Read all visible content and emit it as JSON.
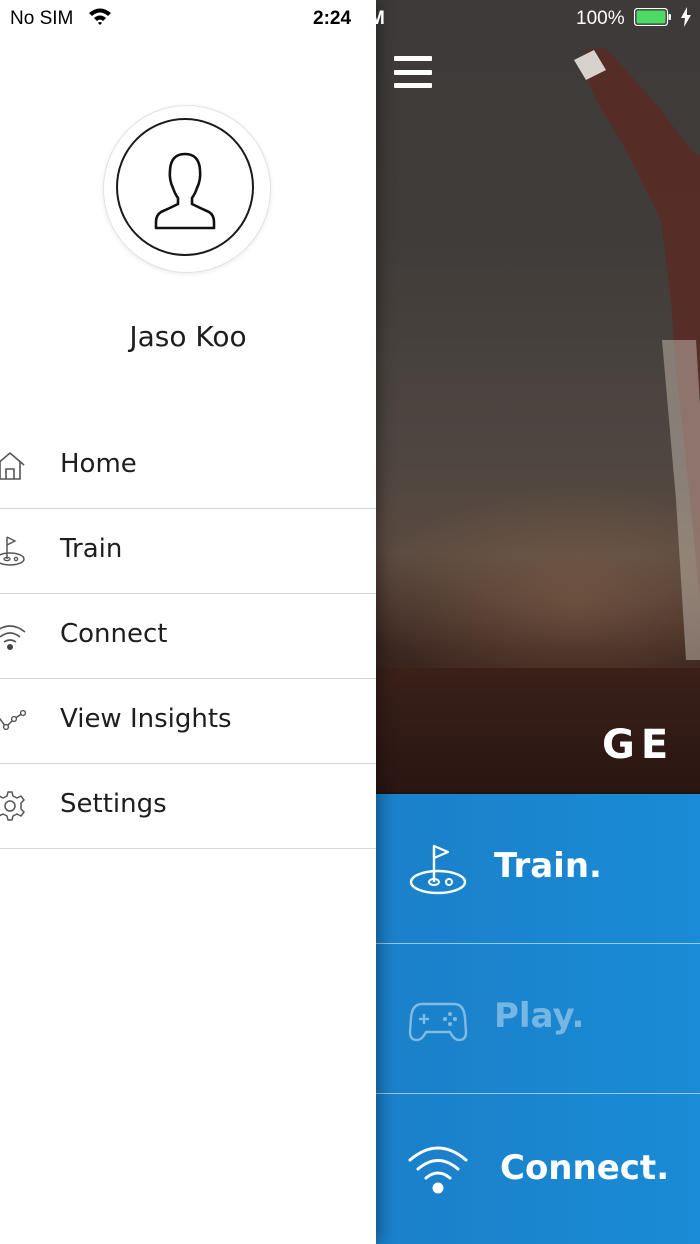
{
  "status_bar": {
    "carrier": "No SIM",
    "time_main": "2:24",
    "time_suffix": " PM",
    "battery_percent": "100%"
  },
  "drawer": {
    "username": "Jaso Koo",
    "menu": [
      {
        "label": "Home",
        "icon": "home-icon"
      },
      {
        "label": "Train",
        "icon": "golf-flag-icon"
      },
      {
        "label": "Connect",
        "icon": "wifi-icon"
      },
      {
        "label": "View Insights",
        "icon": "insights-icon"
      },
      {
        "label": "Settings",
        "icon": "gear-icon"
      }
    ]
  },
  "main": {
    "logo_text": "GE",
    "tiles": [
      {
        "label": "Train.",
        "icon": "golf-flag-icon",
        "enabled": true
      },
      {
        "label": "Play.",
        "icon": "gamepad-icon",
        "enabled": false
      },
      {
        "label": "Connect.",
        "icon": "wifi-icon",
        "enabled": true
      }
    ]
  },
  "colors": {
    "tile_blue": "#1a8bd6",
    "drawer_bg": "#ffffff",
    "text_dark": "#1e1e1e"
  }
}
